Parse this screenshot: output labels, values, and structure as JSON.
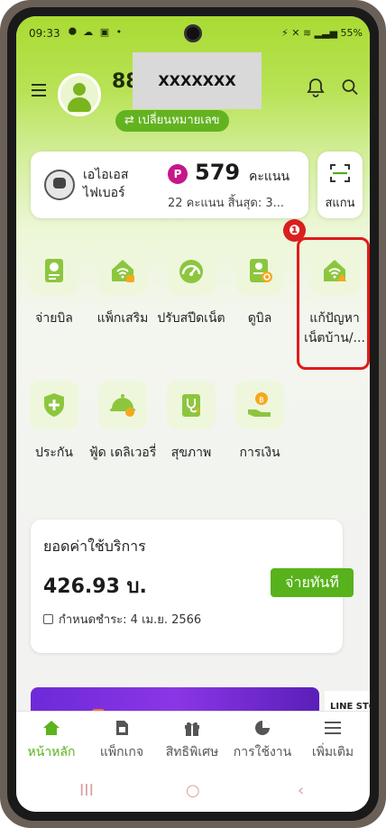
{
  "status_bar": {
    "time": "09:33",
    "left_icons": "⯃ ☁ ▣ •",
    "right_text": "⚡ ✕ ≋ ▂▃▅ 55%"
  },
  "header": {
    "phone_number": "88",
    "masked_label": "XXXXXXX",
    "change_number": "⇄ เปลี่ยนหมายเลข"
  },
  "account": {
    "type": "เอไอเอส ไฟเบอร์",
    "points_badge": "P",
    "points_value": "579",
    "points_unit": "คะแนน",
    "points_expiry": "22 คะแนน สิ้นสุด: 3..."
  },
  "scan": {
    "label": "สแกน"
  },
  "callout": {
    "number": "❶"
  },
  "services": [
    {
      "label": "จ่ายบิล",
      "icon": "bill-icon"
    },
    {
      "label": "แพ็กเสริม",
      "icon": "wifi-home-package-icon"
    },
    {
      "label": "ปรับสปีดเน็ต",
      "icon": "speedometer-icon"
    },
    {
      "label": "ดูบิล",
      "icon": "view-bill-icon"
    },
    {
      "label": "แก้ปัญหาเน็ตบ้าน/...",
      "icon": "wifi-home-warning-icon"
    },
    {
      "label": "ประกัน",
      "icon": "shield-plus-icon"
    },
    {
      "label": "ฟู้ด เดลิเวอรี่",
      "icon": "food-delivery-icon"
    },
    {
      "label": "สุขภาพ",
      "icon": "health-stethoscope-icon"
    },
    {
      "label": "การเงิน",
      "icon": "finance-hand-coin-icon"
    }
  ],
  "bill": {
    "title": "ยอดค่าใช้บริการ",
    "amount": "426.93 บ.",
    "pay_button": "จ่ายทันที",
    "due_text": "กำหนดชำระ: 4 เม.ย. 2566"
  },
  "banner": {
    "side_text": "LINE STO"
  },
  "nav": {
    "items": [
      {
        "label": "หน้าหลัก",
        "icon": "home-icon"
      },
      {
        "label": "แพ็กเกจ",
        "icon": "sim-icon"
      },
      {
        "label": "สิทธิพิเศษ",
        "icon": "gift-icon"
      },
      {
        "label": "การใช้งาน",
        "icon": "pie-chart-icon"
      },
      {
        "label": "เพิ่มเติม",
        "icon": "menu-icon"
      }
    ],
    "active_color": "#5bb31e"
  },
  "system_nav": {
    "recent": "III",
    "home": "○",
    "back": "‹"
  },
  "colors": {
    "brand_green": "#58b21b",
    "highlight_red": "#e01a1a",
    "points_magenta": "#c7158a"
  }
}
